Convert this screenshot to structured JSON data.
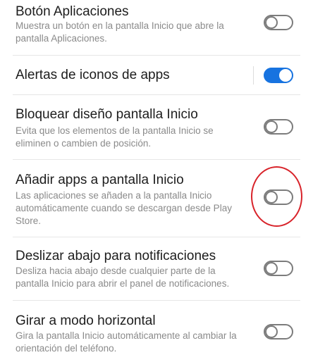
{
  "settings": [
    {
      "title": "Botón Aplicaciones",
      "description": "Muestra un botón en la pantalla Inicio que abre la pantalla Aplicaciones.",
      "enabled": false
    },
    {
      "title": "Alertas de iconos de apps",
      "description": "",
      "enabled": true
    },
    {
      "title": "Bloquear diseño pantalla Inicio",
      "description": "Evita que los elementos de la pantalla Inicio se eliminen o cambien de posición.",
      "enabled": false
    },
    {
      "title": "Añadir apps a pantalla Inicio",
      "description": "Las aplicaciones se añaden a la pantalla Inicio automáticamente cuando se descargan desde Play Store.",
      "enabled": false
    },
    {
      "title": "Deslizar abajo para notificaciones",
      "description": "Desliza hacia abajo desde cualquier parte de la pantalla Inicio para abrir el panel de notificaciones.",
      "enabled": false
    },
    {
      "title": "Girar a modo horizontal",
      "description": "Gira la pantalla Inicio automáticamente al cambiar la orientación del teléfono.",
      "enabled": false
    }
  ],
  "colors": {
    "accent": "#1773e0",
    "highlight": "#d8232a"
  }
}
